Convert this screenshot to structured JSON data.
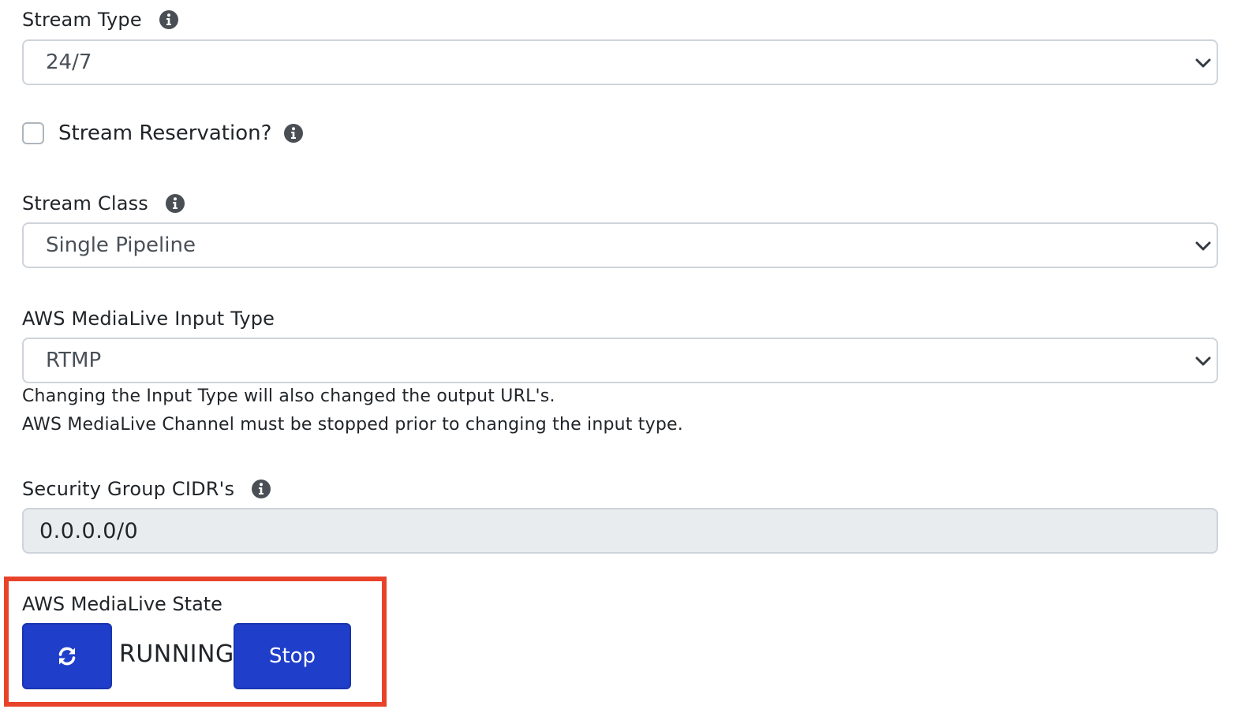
{
  "stream_type": {
    "label": "Stream Type",
    "selected": "24/7"
  },
  "stream_reservation": {
    "label": "Stream Reservation?",
    "checked": false
  },
  "stream_class": {
    "label": "Stream Class",
    "selected": "Single Pipeline"
  },
  "input_type": {
    "label": "AWS MediaLive Input Type",
    "selected": "RTMP",
    "help_line_1": "Changing the Input Type will also changed the output URL's.",
    "help_line_2": "AWS MediaLive Channel must be stopped prior to changing the input type."
  },
  "security_group": {
    "label": "Security Group CIDR's",
    "value": "0.0.0.0/0"
  },
  "medialive_state": {
    "label": "AWS MediaLive State",
    "status": "RUNNING",
    "stop_label": "Stop"
  },
  "colors": {
    "primary_button": "#1f3ec9",
    "highlight_border": "#e8432a",
    "readonly_bg": "#e9ecef"
  },
  "icons": {
    "info": "info-icon",
    "chevron": "chevron-down-icon",
    "refresh": "refresh-icon"
  }
}
